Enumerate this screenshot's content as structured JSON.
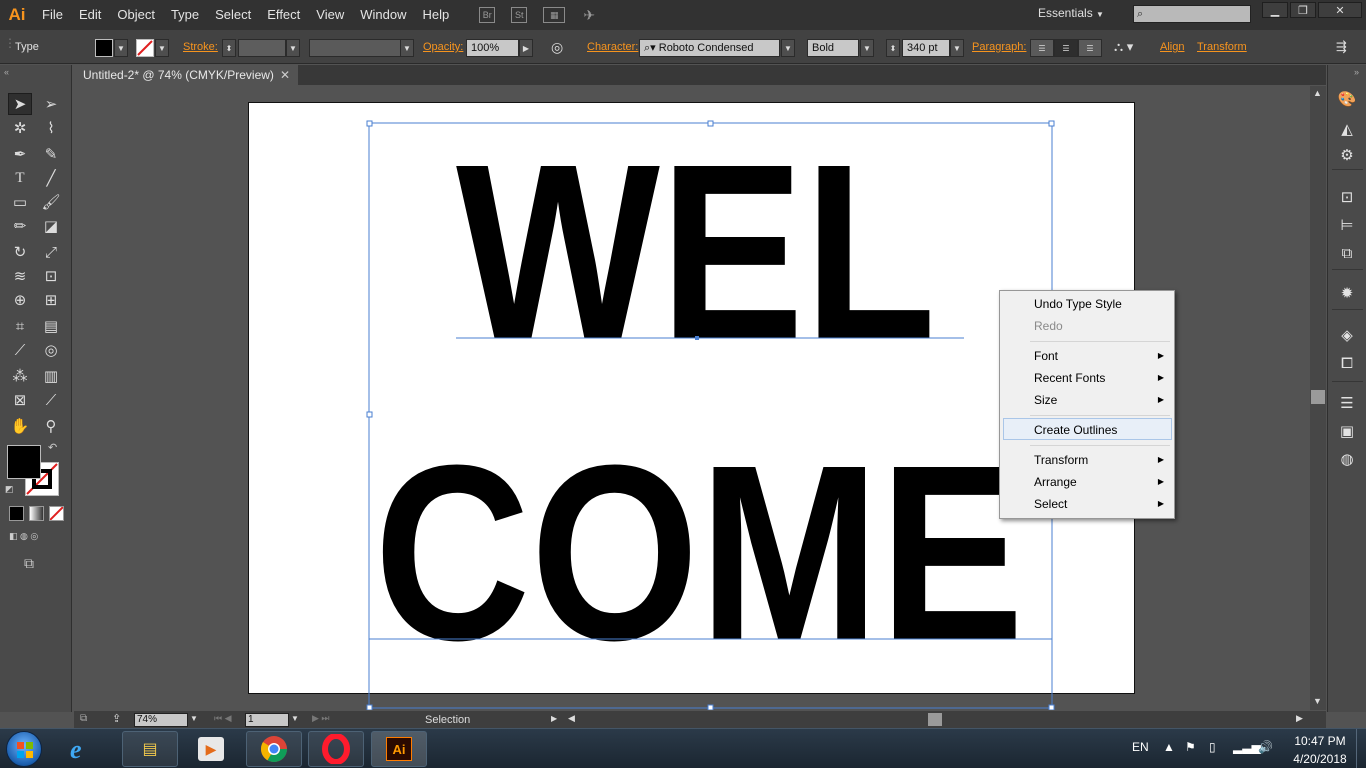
{
  "app": {
    "logo": "Ai",
    "menus": [
      "File",
      "Edit",
      "Object",
      "Type",
      "Select",
      "Effect",
      "View",
      "Window",
      "Help"
    ],
    "menubar_icons": [
      "bridge-icon",
      "stock-icon",
      "arrange-documents-icon",
      "gpu-performance-icon"
    ],
    "br_label": "Br",
    "st_label": "St",
    "workspace": "Essentials",
    "search_placeholder": "",
    "window_buttons": [
      "minimize-icon",
      "restore-icon",
      "close-icon"
    ]
  },
  "control_bar": {
    "tool_name": "Type",
    "stroke_label": "Stroke:",
    "opacity_label": "Opacity:",
    "opacity_value": "100%",
    "character_label": "Character:",
    "font_family": "Roboto Condensed",
    "font_style": "Bold",
    "font_size": "340 pt",
    "paragraph_label": "Paragraph:",
    "align_label": "Align",
    "transform_label": "Transform"
  },
  "document": {
    "tab_title": "Untitled-2* @ 74% (CMYK/Preview)",
    "text_line1": "WEL",
    "text_line2": "COME"
  },
  "context_menu": {
    "items": [
      {
        "label": "Undo Type Style",
        "disabled": false,
        "submenu": false
      },
      {
        "label": "Redo",
        "disabled": true,
        "submenu": false
      },
      {
        "label": "Font",
        "disabled": false,
        "submenu": true
      },
      {
        "label": "Recent Fonts",
        "disabled": false,
        "submenu": true
      },
      {
        "label": "Size",
        "disabled": false,
        "submenu": true
      },
      {
        "label": "Create Outlines",
        "disabled": false,
        "submenu": false,
        "highlighted": true
      },
      {
        "label": "Transform",
        "disabled": false,
        "submenu": true
      },
      {
        "label": "Arrange",
        "disabled": false,
        "submenu": true
      },
      {
        "label": "Select",
        "disabled": false,
        "submenu": true
      }
    ]
  },
  "status_bar": {
    "zoom": "74%",
    "artboard_number": "1",
    "status_text": "Selection"
  },
  "taskbar": {
    "language": "EN",
    "time": "10:47 PM",
    "date": "4/20/2018",
    "apps": [
      "internet-explorer-icon",
      "file-explorer-icon",
      "media-player-icon",
      "chrome-icon",
      "opera-icon",
      "illustrator-icon"
    ],
    "illustrator_label": "Ai"
  },
  "colors": {
    "accent_orange": "#f7941e",
    "selection_blue": "#4a7fd1",
    "menu_highlight": "#e8eff8"
  }
}
